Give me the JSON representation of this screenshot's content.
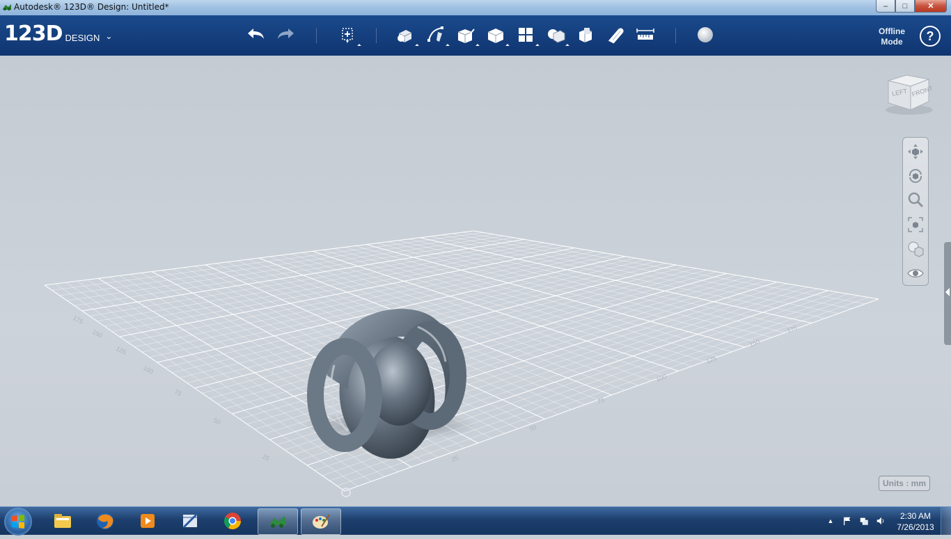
{
  "window": {
    "title": "Autodesk® 123D® Design: Untitled*",
    "controls": {
      "minimize": "–",
      "maximize": "□",
      "close": "✕"
    }
  },
  "app": {
    "logo_main": "123D",
    "logo_sub": "DESIGN",
    "logo_menu": "⌄"
  },
  "toolbar": {
    "items": [
      {
        "name": "undo-icon",
        "label": "Undo"
      },
      {
        "name": "redo-icon",
        "label": "Redo"
      },
      {
        "name": "transform-icon",
        "label": "Transform"
      },
      {
        "name": "primitives-icon",
        "label": "Primitives"
      },
      {
        "name": "sketch-icon",
        "label": "Sketch"
      },
      {
        "name": "construct-icon",
        "label": "Construct"
      },
      {
        "name": "modify-icon",
        "label": "Modify"
      },
      {
        "name": "pattern-icon",
        "label": "Pattern"
      },
      {
        "name": "grouping-icon",
        "label": "Grouping"
      },
      {
        "name": "combine-icon",
        "label": "Combine"
      },
      {
        "name": "snap-icon",
        "label": "Snap"
      },
      {
        "name": "measure-icon",
        "label": "Measure"
      },
      {
        "name": "material-icon",
        "label": "Material"
      }
    ],
    "offline_mode": "Offline Mode",
    "help": "?"
  },
  "viewport": {
    "viewcube_faces": {
      "left": "LEFT",
      "front": "FRONT"
    },
    "grid_labels_front": [
      "25",
      "50",
      "75",
      "100",
      "125",
      "150",
      "175"
    ],
    "grid_labels_left": [
      "25",
      "50",
      "75",
      "100",
      "125",
      "150",
      "175"
    ],
    "units_label": "Units : mm",
    "nav_tools": [
      "pan-icon",
      "orbit-icon",
      "zoom-icon",
      "fit-icon",
      "view-style-icon",
      "visibility-icon"
    ]
  },
  "taskbar": {
    "apps": [
      {
        "name": "windows-explorer-icon"
      },
      {
        "name": "firefox-icon"
      },
      {
        "name": "media-player-icon"
      },
      {
        "name": "design-review-icon"
      },
      {
        "name": "chrome-icon"
      },
      {
        "name": "123d-design-icon",
        "active": true
      },
      {
        "name": "paint-icon",
        "active": true
      }
    ],
    "clock_time": "2:30 AM",
    "clock_date": "7/26/2013",
    "tray_expand": "▲"
  },
  "colors": {
    "toolbar_bg": "#123b78",
    "viewport_bg": "#c9cfd6",
    "model": "#6b7785"
  }
}
